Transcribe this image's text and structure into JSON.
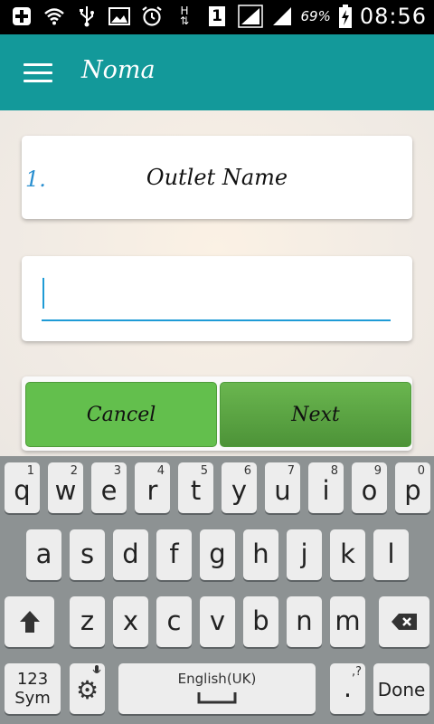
{
  "status_bar": {
    "battery_percent": "69%",
    "time": "08:56",
    "network_type": "H",
    "sim_slot": "1",
    "icons": [
      "add-icon",
      "wifi-icon",
      "usb-icon",
      "image-icon",
      "alarm-icon",
      "network-h-icon",
      "sim-1-icon",
      "signal-1-icon",
      "signal-2-icon",
      "battery-charging-icon"
    ]
  },
  "app_bar": {
    "title": "Noma",
    "menu_icon": "hamburger-menu-icon",
    "color": "#13999a"
  },
  "question": {
    "number": "1.",
    "text": "Outlet Name"
  },
  "answer_input": {
    "value": "",
    "placeholder": ""
  },
  "buttons": {
    "cancel": "Cancel",
    "next": "Next",
    "color": "#63bf4d"
  },
  "keyboard": {
    "row1": [
      {
        "key": "q",
        "hint": "1"
      },
      {
        "key": "w",
        "hint": "2"
      },
      {
        "key": "e",
        "hint": "3"
      },
      {
        "key": "r",
        "hint": "4"
      },
      {
        "key": "t",
        "hint": "5"
      },
      {
        "key": "y",
        "hint": "6"
      },
      {
        "key": "u",
        "hint": "7"
      },
      {
        "key": "i",
        "hint": "8"
      },
      {
        "key": "o",
        "hint": "9"
      },
      {
        "key": "p",
        "hint": "0"
      }
    ],
    "row2": [
      "a",
      "s",
      "d",
      "f",
      "g",
      "h",
      "j",
      "k",
      "l"
    ],
    "row3": [
      "z",
      "x",
      "c",
      "v",
      "b",
      "n",
      "m"
    ],
    "sym_top": "123",
    "sym_bottom": "Sym",
    "space_label": "English(UK)",
    "period": ".",
    "period_hint": ",?",
    "done": "Done"
  }
}
